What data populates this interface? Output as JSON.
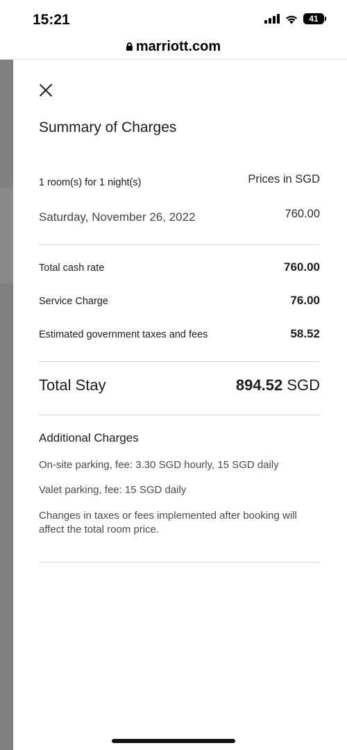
{
  "status_bar": {
    "time": "15:21",
    "battery": "41",
    "icons": [
      "signal-icon",
      "wifi-icon",
      "battery-icon"
    ]
  },
  "browser": {
    "url": "marriott.com",
    "icon": "lock-icon"
  },
  "panel": {
    "close_icon": "close-icon",
    "title": "Summary of Charges",
    "rooms_nights": "1 room(s) for 1 night(s)",
    "currency_note": "Prices in SGD",
    "nightly": [
      {
        "date": "Saturday, November 26, 2022",
        "amount": "760.00"
      }
    ],
    "line_items": [
      {
        "label": "Total cash rate",
        "value": "760.00"
      },
      {
        "label": "Service Charge",
        "value": "76.00"
      },
      {
        "label": "Estimated government taxes and fees",
        "value": "58.52"
      }
    ],
    "total": {
      "label": "Total Stay",
      "amount": "894.52",
      "currency": "SGD"
    },
    "additional": {
      "title": "Additional Charges",
      "notes": [
        "On-site parking, fee: 3.30 SGD hourly, 15 SGD daily",
        "Valet parking, fee: 15 SGD daily",
        "Changes in taxes or fees implemented after booking will affect the total room price."
      ]
    }
  },
  "colors": {
    "text": "#1c1c1c",
    "muted": "#4a4a4a",
    "divider": "#d6d6d6",
    "overlay": "#808080"
  }
}
